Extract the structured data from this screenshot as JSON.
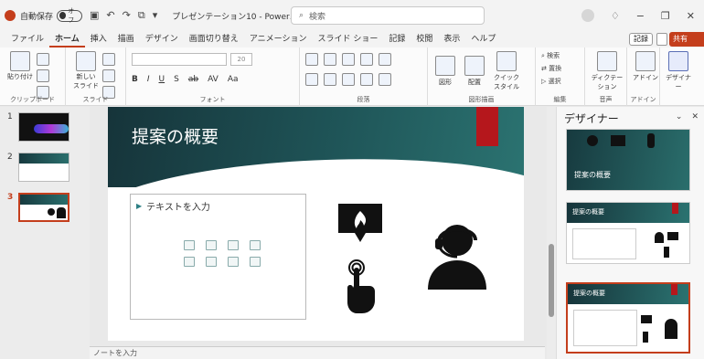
{
  "titlebar": {
    "autosave_label": "自動保存",
    "autosave_state": "オフ",
    "doc_title": "プレゼンテーション10 - Power…",
    "search_placeholder": "検索"
  },
  "tabs": [
    "ファイル",
    "ホーム",
    "挿入",
    "描画",
    "デザイン",
    "画面切り替え",
    "アニメーション",
    "スライド ショー",
    "記録",
    "校閲",
    "表示",
    "ヘルプ"
  ],
  "tab_active_index": 1,
  "tab_right": {
    "record": "記録",
    "share": "共有"
  },
  "ribbon": {
    "groups": {
      "clipboard": "クリップボード",
      "slides": "スライド",
      "font": "フォント",
      "paragraph": "段落",
      "drawing": "図形描画",
      "editing": "編集",
      "voice": "音声",
      "addins": "アドイン"
    },
    "buttons": {
      "paste": "貼り付け",
      "new_slide": "新しい\nスライド",
      "shapes": "図形",
      "arrange": "配置",
      "quick_styles": "クイック\nスタイル",
      "find": "検索",
      "replace": "置換",
      "select": "選択",
      "dictate": "ディクテーション",
      "addins": "アドイン",
      "designer": "デザイナー"
    },
    "font_size_placeholder": "20",
    "format_letters": [
      "B",
      "I",
      "U",
      "S",
      "ab",
      "AV",
      "Aa"
    ]
  },
  "thumbnails": [
    {
      "num": "1",
      "star": "*"
    },
    {
      "num": "2"
    },
    {
      "num": "3"
    }
  ],
  "slide": {
    "title": "提案の概要",
    "content_placeholder": "テキストを入力"
  },
  "notes_placeholder": "ノートを入力",
  "designer": {
    "title": "デザイナー",
    "card_titles": [
      "提案の概要",
      "提案の概要",
      "提案の概要"
    ]
  },
  "colors": {
    "accent": "#c43e1c",
    "header_dark": "#16343a",
    "header_light": "#2b7371",
    "slide_red": "#b5171c"
  }
}
